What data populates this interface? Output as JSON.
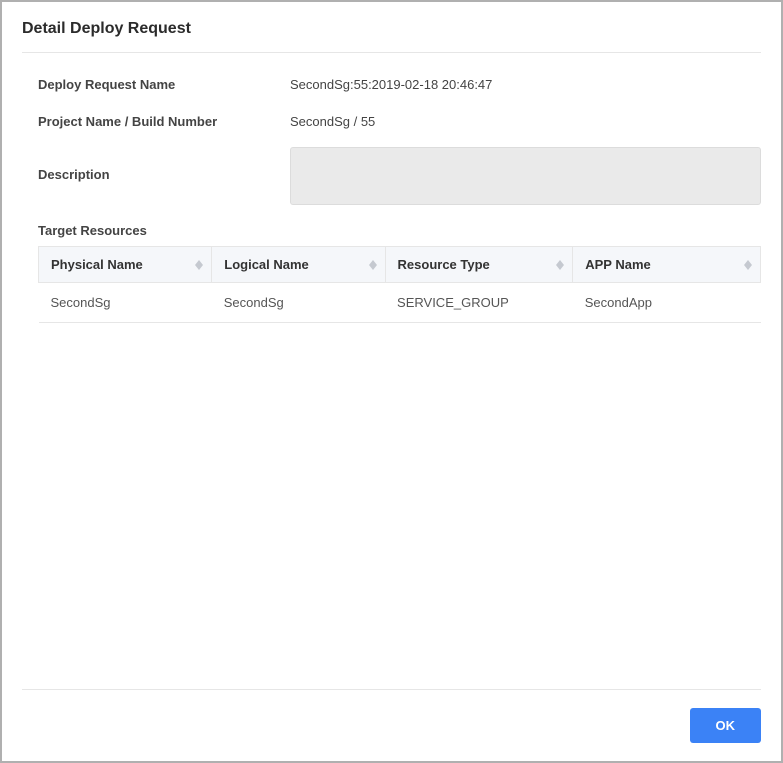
{
  "dialog": {
    "title": "Detail Deploy Request",
    "ok_label": "OK"
  },
  "fields": {
    "deploy_request_name": {
      "label": "Deploy Request Name",
      "value": "SecondSg:55:2019-02-18 20:46:47"
    },
    "project_build": {
      "label": "Project Name / Build Number",
      "value": "SecondSg / 55"
    },
    "description": {
      "label": "Description",
      "value": ""
    },
    "target_resources_label": "Target Resources"
  },
  "table": {
    "headers": {
      "physical_name": "Physical  Name",
      "logical_name": "Logical  Name",
      "resource_type": "Resource  Type",
      "app_name": "APP  Name"
    },
    "rows": [
      {
        "physical_name": "SecondSg",
        "logical_name": "SecondSg",
        "resource_type": "SERVICE_GROUP",
        "app_name": "SecondApp"
      }
    ]
  }
}
